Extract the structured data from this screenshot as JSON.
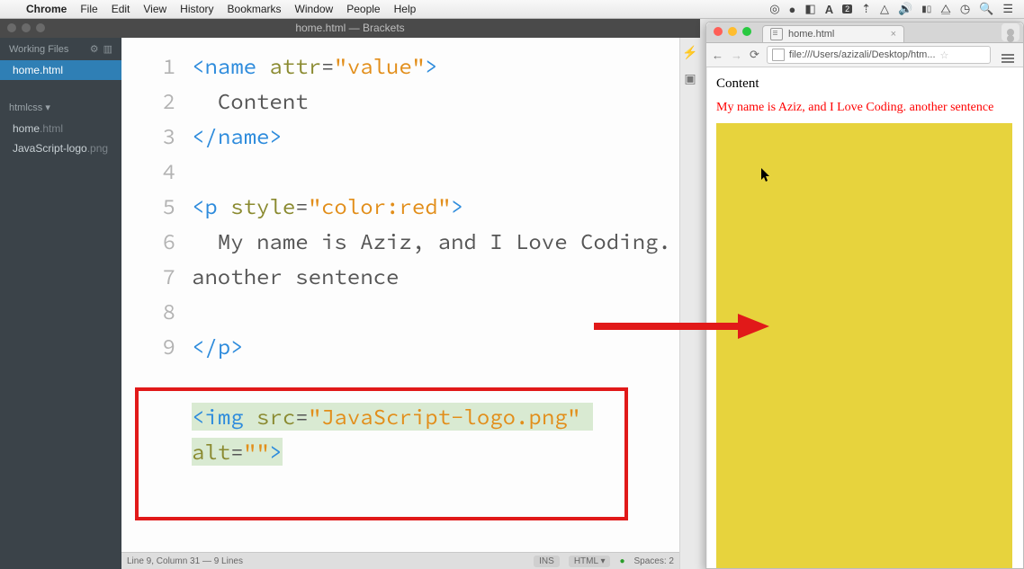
{
  "menubar": {
    "appname": "Chrome",
    "items": [
      "File",
      "Edit",
      "View",
      "History",
      "Bookmarks",
      "Window",
      "People",
      "Help"
    ]
  },
  "brackets": {
    "title": "home.html — Brackets",
    "workingFilesLabel": "Working Files",
    "workingFiles": [
      "home.html"
    ],
    "projectLabel": "htmlcss ▾",
    "projectFiles": [
      {
        "name": "home",
        "ext": ".html"
      },
      {
        "name": "JavaScript-logo",
        "ext": ".png"
      }
    ],
    "lines": [
      "1",
      "2",
      "3",
      "4",
      "5",
      "6",
      "7",
      "8",
      "9"
    ],
    "code": {
      "l1a": "<",
      "l1b": "name ",
      "l1c": "attr",
      "l1d": "=",
      "l1e": "\"value\"",
      "l1f": ">",
      "l2": "  Content",
      "l3a": "</",
      "l3b": "name",
      "l3c": ">",
      "l4": "",
      "l5a": "<",
      "l5b": "p ",
      "l5c": "style",
      "l5d": "=",
      "l5e": "\"color:red\"",
      "l5f": ">",
      "l6": "  My name is Aziz, and I Love Coding. another sentence",
      "l7a": "</",
      "l7b": "p",
      "l7c": ">",
      "l8": "",
      "l9a": "<",
      "l9b": "img ",
      "l9c": "src",
      "l9d": "=",
      "l9e": "\"JavaScript-logo.png\"",
      "l9f": " ",
      "l9g": "alt",
      "l9h": "=",
      "l9i": "\"\"",
      "l9j": ">"
    },
    "status": {
      "pos": "Line 9, Column 31 — 9 Lines",
      "ins": "INS",
      "lang": "HTML ▾",
      "space": "Spaces: 2"
    }
  },
  "chrome": {
    "tabTitle": "home.html",
    "url": "file:///Users/azizali/Desktop/htm...",
    "content1": "Content",
    "content2": "My name is Aziz, and I Love Coding. another sentence"
  }
}
